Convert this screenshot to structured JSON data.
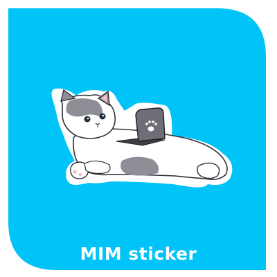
{
  "colors": {
    "background": "#00c3f7",
    "page": "#ffffff",
    "sticker_outline": "#ffffff",
    "cat_fur_gray": "#8e8f96",
    "laptop": "#3e3f45",
    "paw_pad": "#f2c4c6"
  },
  "sticker": {
    "subject": "cat-with-laptop-sticker",
    "icon": "paw-icon"
  },
  "brand": {
    "label": "MIM sticker"
  }
}
